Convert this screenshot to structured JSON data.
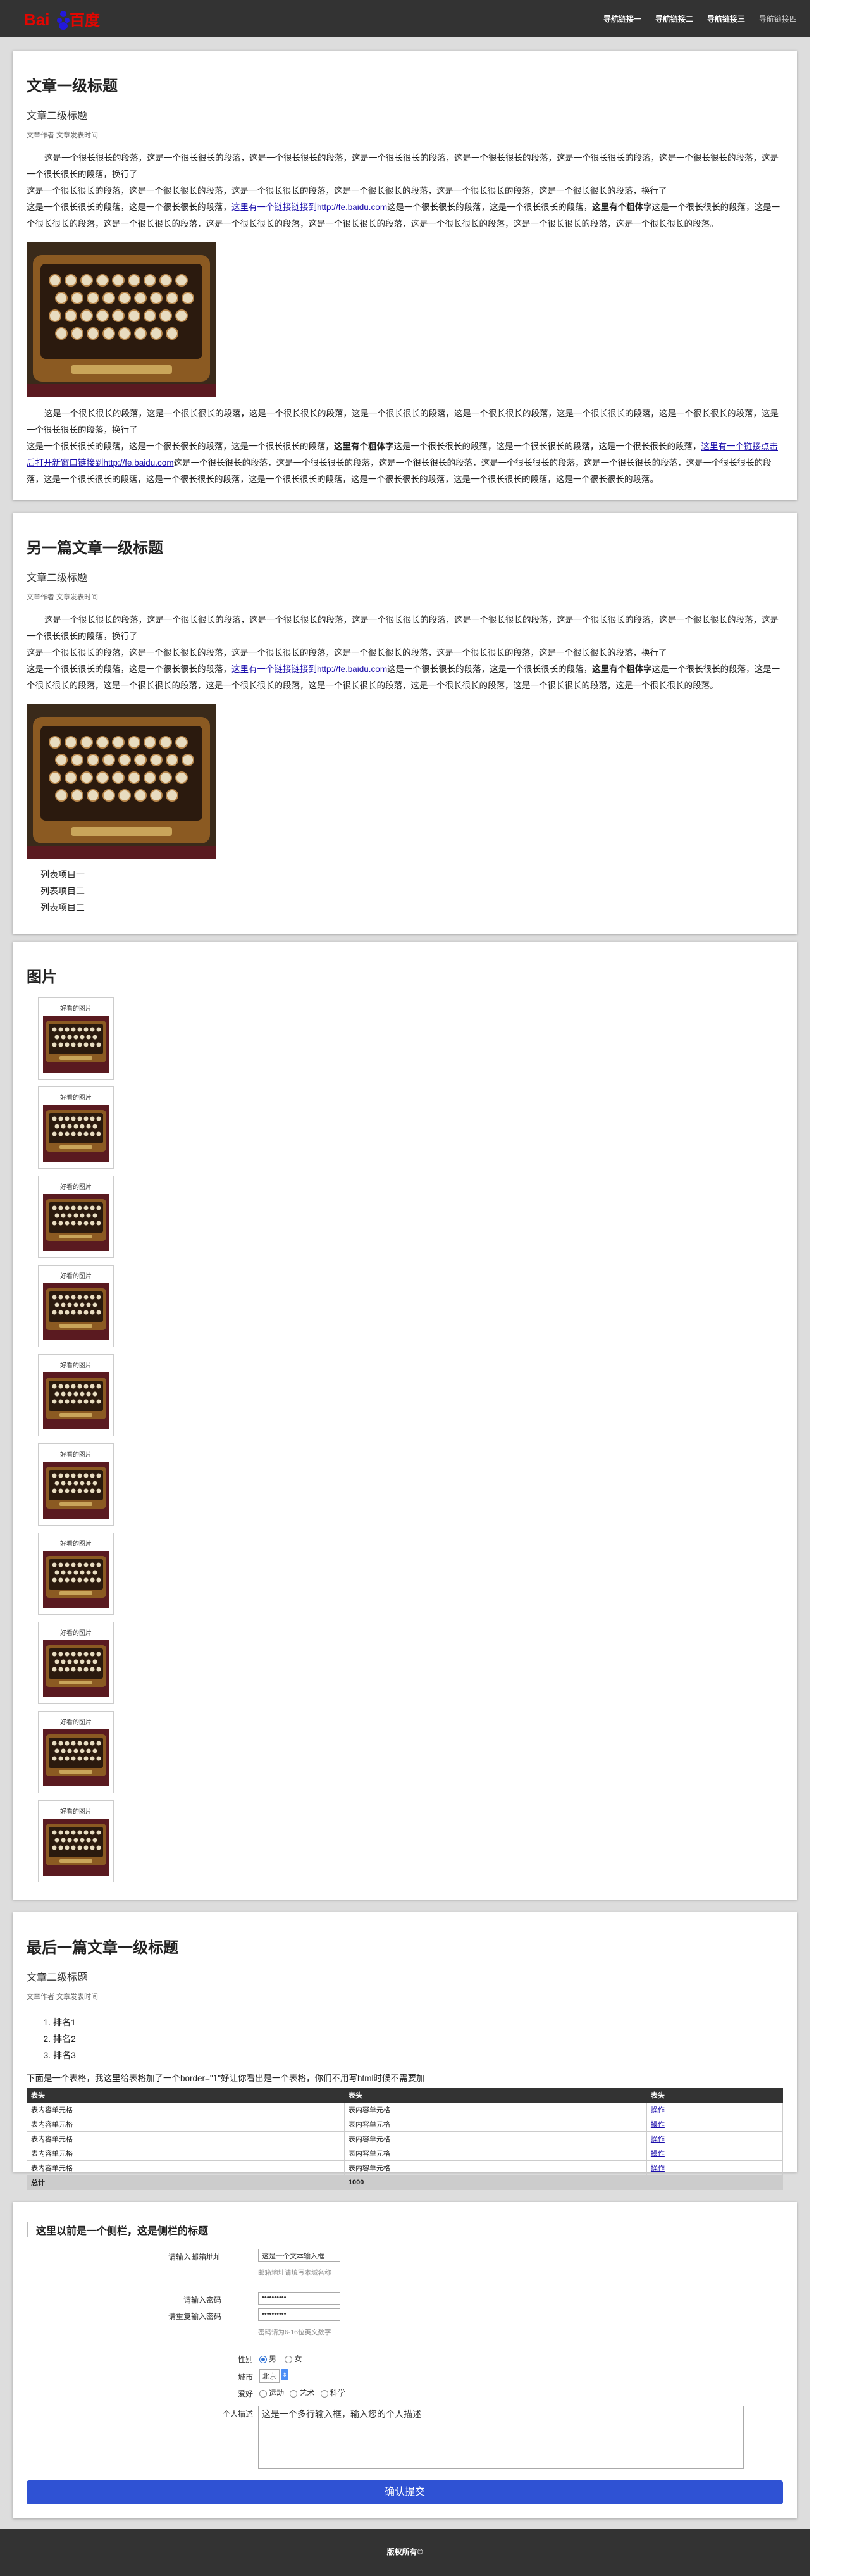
{
  "nav": {
    "logo_text": "Bai百度",
    "links": [
      "导航链接一",
      "导航链接二",
      "导航链接三",
      "导航链接四"
    ]
  },
  "article1": {
    "title": "文章一级标题",
    "subtitle": "文章二级标题",
    "meta": "文章作者 文章发表时间",
    "p1": "这是一个很长很长的段落，这是一个很长很长的段落，这是一个很长很长的段落，这是一个很长很长的段落，这是一个很长很长的段落，这是一个很长很长的段落，这是一个很长很长的段落，这是一个很长很长的段落，换行了",
    "p2a": "这是一个很长很长的段落，这是一个很长很长的段落，这是一个很长很长的段落，这是一个很长很长的段落，这是一个很长很长的段落，这是一个很长很长的段落，换行了",
    "p2b": "这是一个很长很长的段落，这是一个很长很长的段落，",
    "link1": "这里有一个链接链接到http://fe.baidu.com",
    "p2c": "这是一个很长很长的段落，这是一个很长很长的段落，",
    "bold1": "这里有个粗体字",
    "p2d": "这是一个很长很长的段落，这是一个很长很长的段落，这是一个很长很长的段落，这是一个很长很长的段落，这是一个很长很长的段落，这是一个很长很长的段落，这是一个很长很长的段落，这是一个很长很长的段落。",
    "p3a": "这是一个很长很长的段落，这是一个很长很长的段落，这是一个很长很长的段落，这是一个很长很长的段落，这是一个很长很长的段落，这是一个很长很长的段落，这是一个很长很长的段落，这是一个很长很长的段落，换行了",
    "p3b": "这是一个很长很长的段落，这是一个很长很长的段落，这是一个很长很长的段落，",
    "bold2": "这里有个粗体字",
    "p3c": "这是一个很长很长的段落，这是一个很长很长的段落，这是一个很长很长的段落，",
    "link2": "这里有一个链接点击后打开新窗口链接到http://fe.baidu.com",
    "p3d": "这是一个很长很长的段落，这是一个很长很长的段落，这是一个很长很长的段落，这是一个很长很长的段落，这是一个很长很长的段落，这是一个很长很长的段落，这是一个很长很长的段落，这是一个很长很长的段落，这是一个很长很长的段落，这是一个很长很长的段落，这是一个很长很长的段落，这是一个很长很长的段落。"
  },
  "article2": {
    "title": "另一篇文章一级标题",
    "subtitle": "文章二级标题",
    "meta": "文章作者 文章发表时间",
    "list": [
      "列表项目一",
      "列表项目二",
      "列表项目三"
    ]
  },
  "gallery": {
    "title": "图片",
    "caption": "好看的图片",
    "count": 10
  },
  "article3": {
    "title": "最后一篇文章一级标题",
    "subtitle": "文章二级标题",
    "meta": "文章作者 文章发表时间",
    "ranks": [
      "排名1",
      "排名2",
      "排名3"
    ],
    "table_note": "下面是一个表格，我这里给表格加了一个border=\"1\"好让你看出是一个表格，你们不用写html时候不需要加",
    "table": {
      "headers": [
        "表头",
        "表头",
        "表头"
      ],
      "rows": [
        [
          "表内容单元格",
          "表内容单元格",
          "操作"
        ],
        [
          "表内容单元格",
          "表内容单元格",
          "操作"
        ],
        [
          "表内容单元格",
          "表内容单元格",
          "操作"
        ],
        [
          "表内容单元格",
          "表内容单元格",
          "操作"
        ],
        [
          "表内容单元格",
          "表内容单元格",
          "操作"
        ]
      ],
      "summary": [
        "总计",
        "1000",
        ""
      ]
    }
  },
  "sidebar_form": {
    "title": "这里以前是一个侧栏，这是侧栏的标题",
    "email_label": "请输入邮箱地址",
    "email_placeholder": "这是一个文本输入框",
    "email_hint": "邮箱地址请填写本域名称",
    "password_label": "请输入密码",
    "password_value": "••••••••••",
    "password2_label": "请重复输入密码",
    "password2_value": "••••••••••",
    "password_hint": "密码请为6-16位英文数字",
    "gender_label": "性别",
    "gender_male": "男",
    "gender_female": "女",
    "city_label": "城市",
    "city_value": "北京",
    "hobby_label": "爱好",
    "hobbies": [
      "运动",
      "艺术",
      "科学"
    ],
    "bio_label": "个人描述",
    "bio_value": "这是一个多行输入框，输入您的个人描述",
    "submit_label": "确认提交"
  },
  "footer": {
    "text": "版权所有©"
  }
}
